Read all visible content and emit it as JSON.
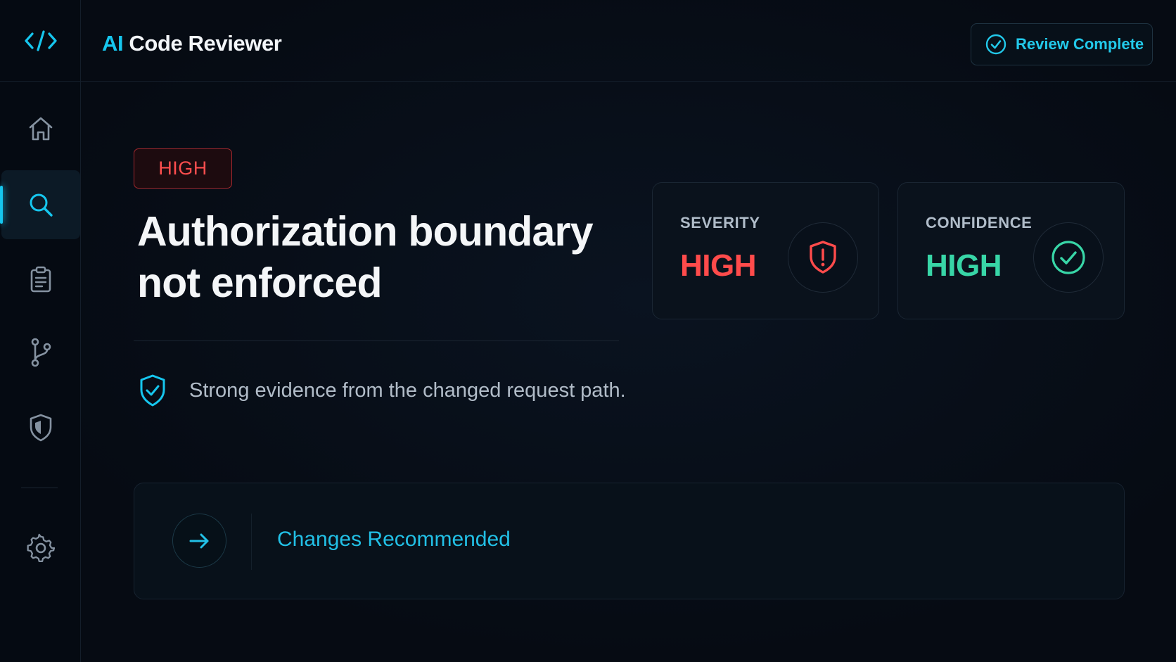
{
  "app": {
    "title_accent": "AI",
    "title_rest": " Code Reviewer",
    "logo_icon": "code-brackets-icon"
  },
  "status": {
    "label": "Review Complete",
    "icon": "check-circle-icon"
  },
  "sidebar": {
    "items": [
      {
        "name": "home",
        "icon": "home-icon",
        "active": false
      },
      {
        "name": "search",
        "icon": "search-icon",
        "active": true
      },
      {
        "name": "clipboard",
        "icon": "clipboard-icon",
        "active": false
      },
      {
        "name": "branch",
        "icon": "git-branch-icon",
        "active": false
      },
      {
        "name": "security",
        "icon": "shield-icon",
        "active": false
      },
      {
        "name": "settings",
        "icon": "gear-icon",
        "active": false
      }
    ]
  },
  "finding": {
    "badge": "HIGH",
    "title": "Authorization boundary not enforced",
    "evidence": "Strong evidence from the changed request path.",
    "evidence_icon": "shield-check-icon"
  },
  "metrics": {
    "severity": {
      "label": "SEVERITY",
      "value": "HIGH",
      "color": "#ff4b4b",
      "icon": "shield-alert-icon"
    },
    "confidence": {
      "label": "CONFIDENCE",
      "value": "HIGH",
      "color": "#38d6a7",
      "icon": "check-circle-icon"
    }
  },
  "action": {
    "label": "Changes Recommended",
    "icon": "arrow-right-icon"
  },
  "colors": {
    "accent": "#16c6ee",
    "danger": "#ff4b4b",
    "success": "#38d6a7",
    "background": "#060b13"
  }
}
